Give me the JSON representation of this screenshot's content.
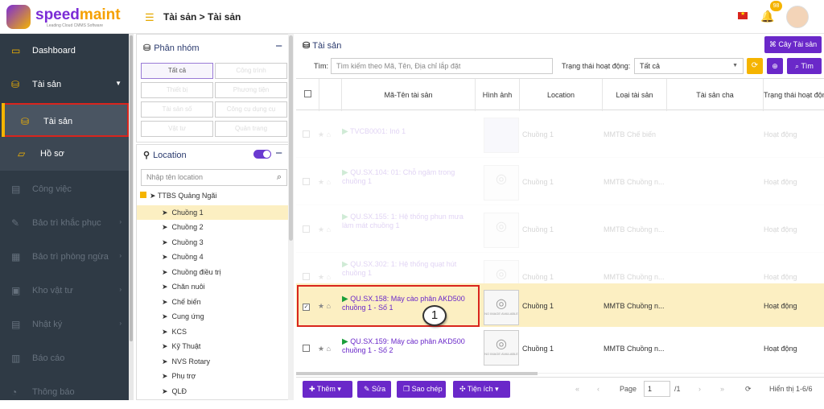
{
  "brand": {
    "name_a": "speed",
    "name_b": "maint",
    "tagline": "Leading Cloud CMMS Software"
  },
  "header": {
    "breadcrumb": "Tài sản > Tài sản",
    "notif_count": "98"
  },
  "sidebar": {
    "items": [
      {
        "label": "Dashboard",
        "icon": "monitor-icon"
      },
      {
        "label": "Tài sản",
        "icon": "assets-icon"
      },
      {
        "label": "Tài sản",
        "icon": "assets-icon"
      },
      {
        "label": "Hồ sơ",
        "icon": "folder-icon"
      },
      {
        "label": "Công việc",
        "icon": "task-icon"
      },
      {
        "label": "Bảo trì khắc phục",
        "icon": "wrench-icon"
      },
      {
        "label": "Bảo trì phòng ngừa",
        "icon": "calendar-icon"
      },
      {
        "label": "Kho vật tư",
        "icon": "box-icon"
      },
      {
        "label": "Nhật ký",
        "icon": "log-icon"
      },
      {
        "label": "Báo cáo",
        "icon": "chart-icon"
      },
      {
        "label": "Thông báo",
        "icon": "bell-icon"
      }
    ]
  },
  "group_panel": {
    "title": "Phân nhóm",
    "buttons": [
      "Tất cả",
      "Công trình",
      "Thiết bị",
      "Phương tiện",
      "Tài sản số",
      "Công cụ dụng cụ",
      "Vật tư",
      "Quản trang"
    ]
  },
  "location_panel": {
    "title": "Location",
    "search_placeholder": "Nhập tên location",
    "root": "TTBS Quảng Ngãi",
    "nodes": [
      "Chuồng 1",
      "Chuồng 2",
      "Chuồng 3",
      "Chuồng 4",
      "Chuồng điều trị",
      "Chăn nuôi",
      "Chế biến",
      "Cung ứng",
      "KCS",
      "Kỹ Thuật",
      "NVS Rotary",
      "Phụ trợ",
      "QLĐ"
    ]
  },
  "main": {
    "title": "Tài sản",
    "tree_button": "Cây Tài sản",
    "search_label": "Tìm:",
    "search_placeholder": "Tìm kiếm theo Mã, Tên, Địa chỉ lắp đặt",
    "status_label": "Trạng thái hoạt động:",
    "status_value": "Tất cả",
    "search_button": "Tìm",
    "columns": [
      "Mã-Tên tài sản",
      "Hình ảnh",
      "Location",
      "Loại tài sản",
      "Tài sản cha",
      "Trạng thái hoạt động"
    ],
    "rows": [
      {
        "name": "TVCB0001: Inó 1",
        "location": "Chuồng 1",
        "type": "MMTB Chế biến",
        "status": "Hoạt động"
      },
      {
        "name": "QU.SX.104: 01: Chỗ ngâm trong chuồng 1",
        "location": "Chuồng 1",
        "type": "MMTB Chuồng n...",
        "status": "Hoạt động"
      },
      {
        "name": "QU.SX.155: 1: Hệ thống phun mưa làm mát chuồng 1",
        "location": "Chuồng 1",
        "type": "MMTB Chuồng n...",
        "status": "Hoạt động"
      },
      {
        "name": "QU.SX.302: 1: Hệ thống quạt hút chuồng 1",
        "location": "Chuồng 1",
        "type": "MMTB Chuồng n...",
        "status": "Hoạt động"
      },
      {
        "name": "QU.SX.158: Máy cào phân AKD500 chuồng 1 - Số 1",
        "location": "Chuồng 1",
        "type": "MMTB Chuồng n...",
        "status": "Hoạt động"
      },
      {
        "name": "QU.SX.159: Máy cào phân AKD500 chuồng 1 - Số 2",
        "location": "Chuồng 1",
        "type": "MMTB Chuồng n...",
        "status": "Hoạt động"
      }
    ],
    "no_image_text": "NO IMAGE AVAILABLE",
    "callout": "1"
  },
  "footer": {
    "add": "Thêm",
    "edit": "Sửa",
    "copy": "Sao chép",
    "util": "Tiện ích",
    "page_label": "Page",
    "page_value": "1",
    "page_total": "/1",
    "showing": "Hiển thị 1-6/6"
  },
  "colors": {
    "primary": "#6a28c9",
    "accent": "#f5b400",
    "sidebar": "#2f3a45",
    "highlight": "#fcefc2",
    "alert": "#d9251d"
  }
}
